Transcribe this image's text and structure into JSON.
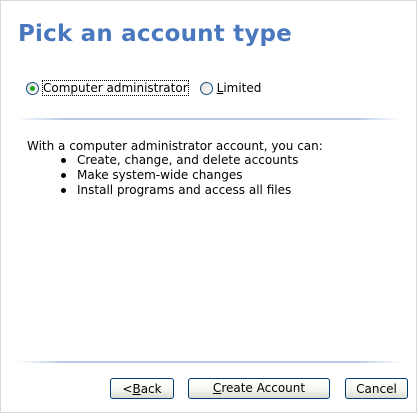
{
  "page_title": "Pick an account type",
  "account_types": {
    "admin": {
      "label": "Computer administrator",
      "selected": true
    },
    "limited": {
      "label": "Limited",
      "selected": false
    }
  },
  "description": "With a computer administrator account, you can:",
  "bullets": [
    "Create, change, and delete accounts",
    "Make system-wide changes",
    "Install programs and access all files"
  ],
  "buttons": {
    "back_prefix": "< ",
    "back_mnemonic": "B",
    "back_rest": "ack",
    "create_mnemonic": "C",
    "create_rest": "reate Account",
    "cancel": "Cancel"
  },
  "colors": {
    "title": "#4a78bf",
    "radio_selected": "#21a121",
    "separator": "#b7c9e6",
    "button_border": "#003c74"
  }
}
